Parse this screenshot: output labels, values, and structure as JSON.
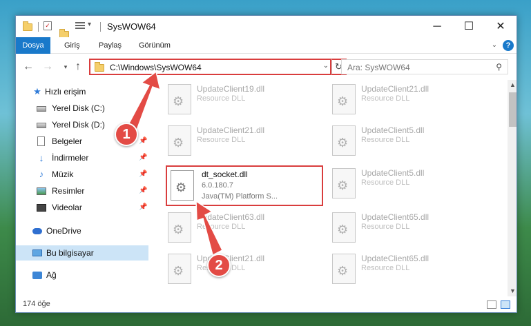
{
  "window": {
    "title": "SysWOW64",
    "minimize": "─",
    "maximize": "☐",
    "close": "✕"
  },
  "ribbon": {
    "tabs": [
      "Dosya",
      "Giriş",
      "Paylaş",
      "Görünüm"
    ],
    "help": "?"
  },
  "address": {
    "path": "C:\\Windows\\SysWOW64",
    "search_placeholder": "Ara: SysWOW64"
  },
  "nav": {
    "items": [
      {
        "label": "Hızlı erişim",
        "icon": "star-icon",
        "pinned": false
      },
      {
        "label": "Yerel Disk (C:)",
        "icon": "disk-icon",
        "pinned": false
      },
      {
        "label": "Yerel Disk (D:)",
        "icon": "disk-icon",
        "pinned": false
      },
      {
        "label": "Belgeler",
        "icon": "documents-icon",
        "pinned": true
      },
      {
        "label": "İndirmeler",
        "icon": "downloads-icon",
        "pinned": true
      },
      {
        "label": "Müzik",
        "icon": "music-icon",
        "pinned": true
      },
      {
        "label": "Resimler",
        "icon": "pictures-icon",
        "pinned": true
      },
      {
        "label": "Videolar",
        "icon": "videos-icon",
        "pinned": true
      },
      {
        "label": "OneDrive",
        "icon": "cloud-icon",
        "pinned": false
      },
      {
        "label": "Bu bilgisayar",
        "icon": "computer-icon",
        "pinned": false,
        "selected": true
      },
      {
        "label": "Ağ",
        "icon": "network-icon",
        "pinned": false
      }
    ]
  },
  "files": {
    "left_column": [
      {
        "name": "UpdateClient19.dll",
        "type": "Resource DLL"
      },
      {
        "name": "UpdateClient21.dll",
        "type": "Resource DLL"
      },
      {
        "name": "dt_socket.dll",
        "version": "6.0.180.7",
        "type": "Java(TM) Platform S...",
        "highlighted": true
      },
      {
        "name": "UpdateClient63.dll",
        "type": "Resource DLL"
      },
      {
        "name": "UpdateClient21.dll",
        "type": "Resource DLL"
      }
    ],
    "right_column": [
      {
        "name": "UpdateClient21.dll",
        "type": "Resource DLL"
      },
      {
        "name": "UpdateClient5.dll",
        "type": "Resource DLL"
      },
      {
        "name": "UpdateClient5.dll",
        "type": "Resource DLL"
      },
      {
        "name": "UpdateClient65.dll",
        "type": "Resource DLL"
      },
      {
        "name": "UpdateClient65.dll",
        "type": "Resource DLL"
      }
    ]
  },
  "status": {
    "count": "174 öğe"
  },
  "annotations": {
    "badge1": "1",
    "badge2": "2",
    "color": "#e34b45"
  }
}
